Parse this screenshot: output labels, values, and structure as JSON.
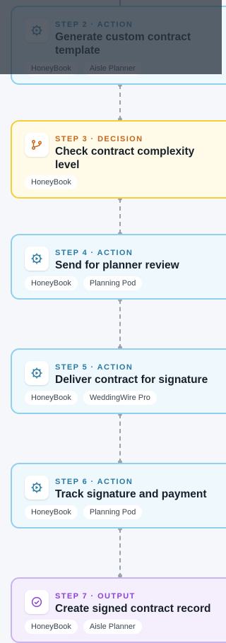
{
  "steps": [
    {
      "eyebrow": "STEP 2 · ACTION",
      "title": "Generate custom contract template",
      "tags": [
        "HoneyBook",
        "Aisle Planner"
      ]
    },
    {
      "eyebrow": "STEP 3 · DECISION",
      "title": "Check contract complexity level",
      "tags": [
        "HoneyBook"
      ]
    },
    {
      "eyebrow": "STEP 4 · ACTION",
      "title": "Send for planner review",
      "tags": [
        "HoneyBook",
        "Planning Pod"
      ]
    },
    {
      "eyebrow": "STEP 5 · ACTION",
      "title": "Deliver contract for signature",
      "tags": [
        "HoneyBook",
        "WeddingWire Pro"
      ]
    },
    {
      "eyebrow": "STEP 6 · ACTION",
      "title": "Track signature and payment",
      "tags": [
        "HoneyBook",
        "Planning Pod"
      ]
    },
    {
      "eyebrow": "STEP 7 · OUTPUT",
      "title": "Create signed contract record",
      "tags": [
        "HoneyBook",
        "Aisle Planner"
      ]
    }
  ],
  "icons": {
    "action": "gear-play-icon",
    "decision": "branch-icon",
    "output": "check-circle-icon"
  },
  "colors": {
    "action_border": "#8ed0ee",
    "decision_border": "#f4cf3a",
    "output_border": "#cab3ef"
  }
}
